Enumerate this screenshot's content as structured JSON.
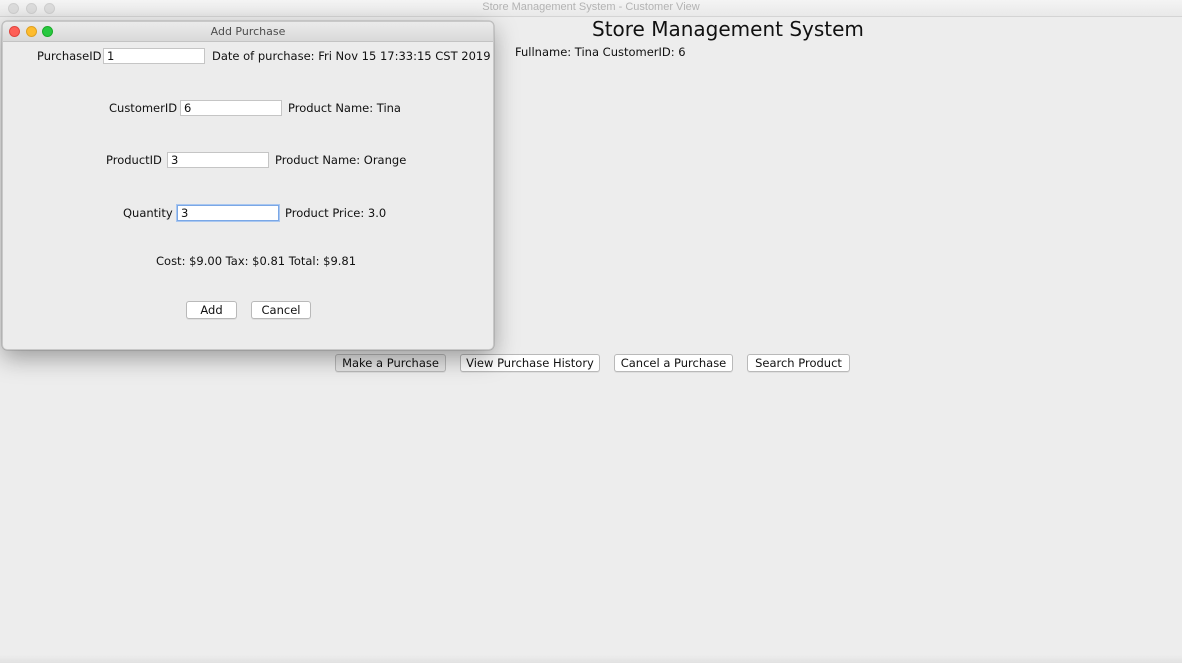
{
  "main_window": {
    "title": "Store Management System - Customer View",
    "heading": "Store Management System",
    "customer_info": "Fullname: Tina CustomerID: 6",
    "buttons": {
      "make_purchase": "Make a Purchase",
      "view_history": "View Purchase History",
      "cancel_purchase": "Cancel a Purchase",
      "search_product": "Search Product"
    }
  },
  "dialog": {
    "title": "Add Purchase",
    "purchase_id_label": "PurchaseID",
    "purchase_id_value": "1",
    "date_label": "Date of purchase: Fri Nov 15 17:33:15 CST 2019",
    "customer_id_label": "CustomerID",
    "customer_id_value": "6",
    "customer_name_label": "Product Name: Tina",
    "product_id_label": "ProductID",
    "product_id_value": "3",
    "product_name_label": "Product Name: Orange",
    "quantity_label": "Quantity",
    "quantity_value": "3",
    "product_price_label": "Product Price: 3.0",
    "summary": "Cost: $9.00 Tax: $0.81 Total: $9.81",
    "add_button": "Add",
    "cancel_button": "Cancel"
  },
  "colors": {
    "close": "#fe5f57",
    "minimize": "#febc2e",
    "zoom": "#28c840",
    "window_bg": "#ededed",
    "focus_ring": "#7aa7e6"
  }
}
